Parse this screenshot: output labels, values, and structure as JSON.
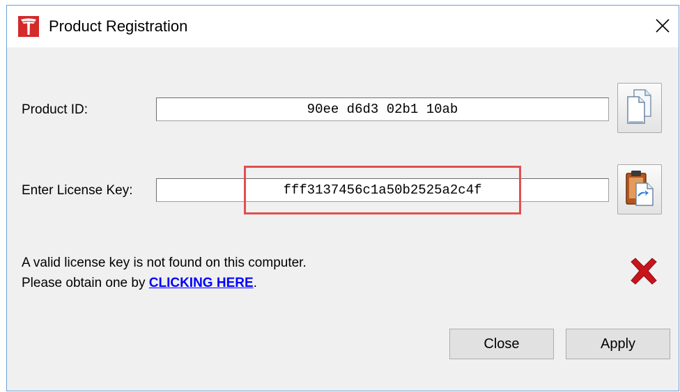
{
  "window": {
    "title": "Product Registration",
    "app_icon": "tesla-t-logo-icon",
    "close_icon": "close-icon"
  },
  "product_id": {
    "label": "Product ID:",
    "value": "90ee d6d3 02b1 10ab",
    "copy_button_icon": "copy-documents-icon"
  },
  "license_key": {
    "label": "Enter License Key:",
    "value": "fff3137456c1a50b2525a2c4f",
    "paste_button_icon": "paste-clipboard-icon"
  },
  "message": {
    "line1": "A valid license key is not found on this computer.",
    "line2_prefix": "Please obtain one by ",
    "link_text": "CLICKING HERE",
    "line2_suffix": ".",
    "status_icon": "red-x-icon"
  },
  "buttons": {
    "close_label": "Close",
    "apply_label": "Apply"
  },
  "colors": {
    "highlight": "#e0504f",
    "link": "#0000ff",
    "status_invalid": "#c8141c"
  }
}
